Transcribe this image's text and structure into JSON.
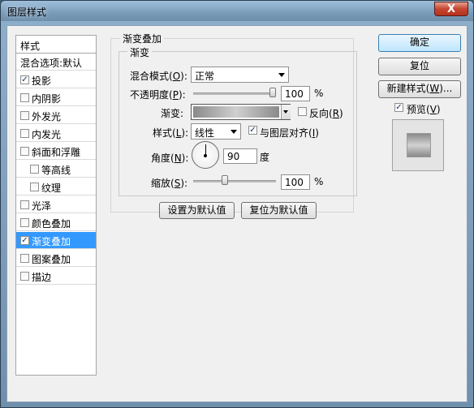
{
  "window": {
    "title": "图层样式",
    "close_label": "X"
  },
  "sidebar": {
    "header": "样式",
    "items": [
      {
        "label": "混合选项:默认",
        "checkbox": false,
        "checked": false,
        "selected": false,
        "indent": false
      },
      {
        "label": "投影",
        "checkbox": true,
        "checked": true,
        "selected": false,
        "indent": false
      },
      {
        "label": "内阴影",
        "checkbox": true,
        "checked": false,
        "selected": false,
        "indent": false
      },
      {
        "label": "外发光",
        "checkbox": true,
        "checked": false,
        "selected": false,
        "indent": false
      },
      {
        "label": "内发光",
        "checkbox": true,
        "checked": false,
        "selected": false,
        "indent": false
      },
      {
        "label": "斜面和浮雕",
        "checkbox": true,
        "checked": false,
        "selected": false,
        "indent": false
      },
      {
        "label": "等高线",
        "checkbox": true,
        "checked": false,
        "selected": false,
        "indent": true
      },
      {
        "label": "纹理",
        "checkbox": true,
        "checked": false,
        "selected": false,
        "indent": true
      },
      {
        "label": "光泽",
        "checkbox": true,
        "checked": false,
        "selected": false,
        "indent": false
      },
      {
        "label": "颜色叠加",
        "checkbox": true,
        "checked": false,
        "selected": false,
        "indent": false
      },
      {
        "label": "渐变叠加",
        "checkbox": true,
        "checked": true,
        "selected": true,
        "indent": false
      },
      {
        "label": "图案叠加",
        "checkbox": true,
        "checked": false,
        "selected": false,
        "indent": false
      },
      {
        "label": "描边",
        "checkbox": true,
        "checked": false,
        "selected": false,
        "indent": false
      }
    ]
  },
  "panel": {
    "outer_title": "渐变叠加",
    "inner_title": "渐变",
    "blend_mode": {
      "label": "混合模式(",
      "key": "O",
      "close": "):",
      "value": "正常"
    },
    "opacity": {
      "label": "不透明度(",
      "key": "P",
      "close": "):",
      "value": "100",
      "unit": "%",
      "fraction": 1.0
    },
    "gradient": {
      "label": "渐变:",
      "reverse_label": "反向(",
      "reverse_key": "R",
      "reverse_close": ")",
      "reverse_checked": false
    },
    "style": {
      "label": "样式(",
      "key": "L",
      "close": "):",
      "value": "线性",
      "align_label": "与图层对齐(",
      "align_key": "I",
      "align_close": ")",
      "align_checked": true
    },
    "angle": {
      "label": "角度(",
      "key": "N",
      "close": "):",
      "value": "90",
      "unit": "度"
    },
    "scale": {
      "label": "缩放(",
      "key": "S",
      "close": "):",
      "value": "100",
      "unit": "%",
      "fraction": 0.4
    },
    "set_default_label": "设置为默认值",
    "reset_default_label": "复位为默认值"
  },
  "actions": {
    "ok_label": "确定",
    "reset_label": "复位",
    "new_style_label": "新建样式(",
    "new_style_key": "W",
    "new_style_close": ")...",
    "preview_label": "预览(",
    "preview_key": "V",
    "preview_close": ")",
    "preview_checked": true
  },
  "colors": {
    "accent_selected": "#3399ff",
    "dialog_bg": "#f0f0f0"
  }
}
